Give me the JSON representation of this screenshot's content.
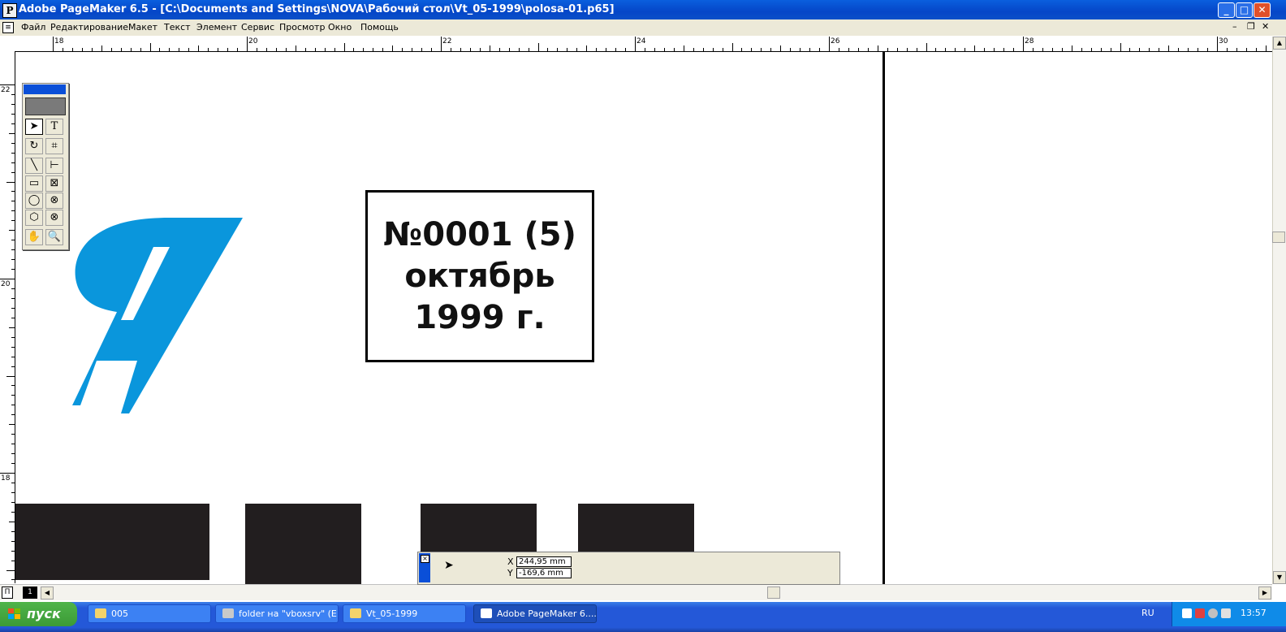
{
  "window": {
    "title": "Adobe PageMaker 6.5 - [C:\\Documents and Settings\\NOVA\\Рабочий стол\\Vt_05-1999\\polosa-01.p65]",
    "controls": [
      "_",
      "□",
      "✕"
    ]
  },
  "menu": {
    "items": [
      "Файл",
      "Редактирование",
      "Макет",
      "Текст",
      "Элемент",
      "Сервис",
      "Просмотр",
      "Окно",
      "Помощь"
    ],
    "mdi_controls": [
      "–",
      "❐",
      "✕"
    ]
  },
  "rulers": {
    "top_labels": [
      "18",
      "20",
      "22",
      "24",
      "26",
      "28",
      "30"
    ],
    "left_labels": [
      "22",
      "20",
      "18"
    ]
  },
  "document": {
    "logo_letter": "Я",
    "logo_color": "#0a96dc",
    "stamp": {
      "line1": "№0001 (5)",
      "line2": "октябрь",
      "line3": "1999 г."
    },
    "block_color": "#221e1f"
  },
  "toolbox": {
    "tools": [
      "pointer",
      "text",
      "rotate",
      "crop",
      "line",
      "constrained-line",
      "rectangle",
      "rectangle-frame",
      "ellipse",
      "ellipse-frame",
      "polygon",
      "polygon-frame",
      "hand",
      "zoom"
    ]
  },
  "page_tabs": {
    "left_right": "П",
    "page_1": "1"
  },
  "control_palette": {
    "x_label": "X",
    "x_value": "244,95 mm",
    "y_label": "Y",
    "y_value": "-169,6 mm"
  },
  "taskbar": {
    "start_label": "пуск",
    "tasks": [
      {
        "label": "005"
      },
      {
        "label": "folder на \"vboxsrv\" (E:)"
      },
      {
        "label": "Vt_05-1999"
      },
      {
        "label": "Adobe PageMaker 6...."
      }
    ],
    "language": "RU",
    "clock": "13:57"
  }
}
